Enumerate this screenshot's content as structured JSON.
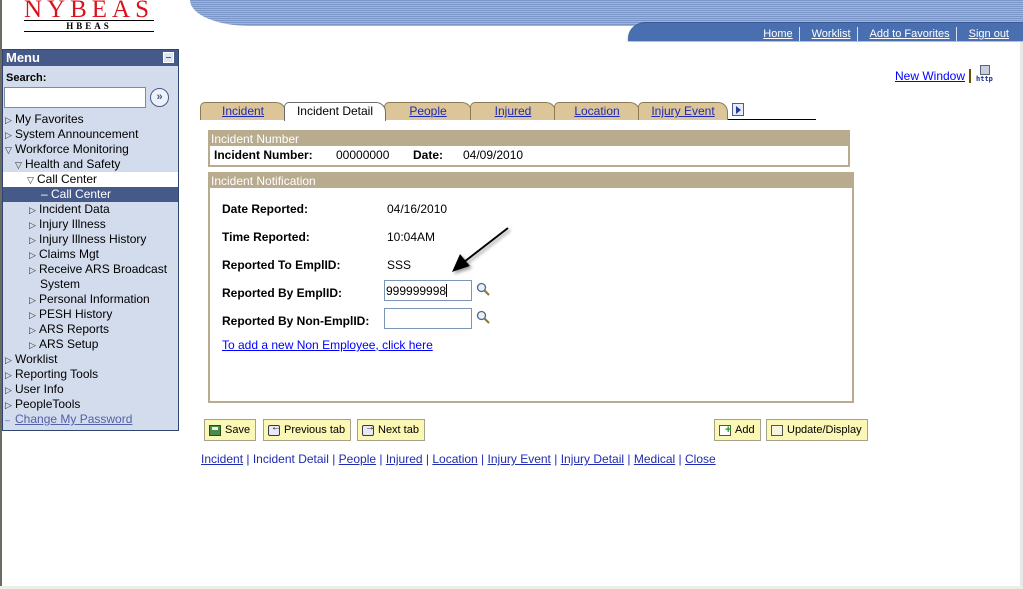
{
  "logo": {
    "main": "NYBEAS",
    "sub": "HBEAS"
  },
  "header_nav": [
    {
      "label": "Home"
    },
    {
      "label": "Worklist"
    },
    {
      "label": "Add to Favorites"
    },
    {
      "label": "Sign out"
    }
  ],
  "menu": {
    "title": "Menu",
    "search_label": "Search:",
    "search_value": "",
    "items": [
      {
        "label": "My Favorites",
        "icon": "triangle-right"
      },
      {
        "label": "System Announcement",
        "icon": "triangle-right"
      },
      {
        "label": "Workforce Monitoring",
        "icon": "triangle-down"
      },
      {
        "label": "Health and Safety",
        "icon": "triangle-down"
      },
      {
        "label": "Call Center",
        "icon": "triangle-down"
      },
      {
        "label": "Call Center",
        "icon": "dash",
        "selected": true
      },
      {
        "label": "Incident Data",
        "icon": "triangle-right"
      },
      {
        "label": "Injury Illness",
        "icon": "triangle-right"
      },
      {
        "label": "Injury Illness History",
        "icon": "triangle-right"
      },
      {
        "label": "Claims Mgt",
        "icon": "triangle-right"
      },
      {
        "label": "Receive ARS Broadcast",
        "icon": "triangle-right"
      },
      {
        "label": "System",
        "icon": ""
      },
      {
        "label": "Personal Information",
        "icon": "triangle-right"
      },
      {
        "label": "PESH History",
        "icon": "triangle-right"
      },
      {
        "label": "ARS Reports",
        "icon": "triangle-right"
      },
      {
        "label": "ARS Setup",
        "icon": "triangle-right"
      },
      {
        "label": "Worklist",
        "icon": "triangle-right"
      },
      {
        "label": "Reporting Tools",
        "icon": "triangle-right"
      },
      {
        "label": "User Info",
        "icon": "triangle-right"
      },
      {
        "label": "PeopleTools",
        "icon": "triangle-right"
      },
      {
        "label": "Change My Password",
        "icon": "dash"
      }
    ]
  },
  "new_window": {
    "label": "New Window",
    "icon": "http-icon"
  },
  "tabs": [
    {
      "label": "Incident",
      "active": false
    },
    {
      "label": "Incident Detail",
      "active": true
    },
    {
      "label": "People",
      "active": false
    },
    {
      "label": "Injured",
      "active": false
    },
    {
      "label": "Location",
      "active": false
    },
    {
      "label": "Injury Event",
      "active": false
    }
  ],
  "incident_number_group": {
    "title": "Incident Number",
    "number_label": "Incident Number:",
    "number_value": "00000000",
    "date_label": "Date:",
    "date_value": "04/09/2010"
  },
  "notification_group": {
    "title": "Incident Notification",
    "date_reported_label": "Date Reported:",
    "date_reported_value": "04/16/2010",
    "time_reported_label": "Time Reported:",
    "time_reported_value": "10:04AM",
    "reported_to_label": "Reported To EmplID:",
    "reported_to_value": "SSS",
    "reported_by_label": "Reported By EmplID:",
    "reported_by_value": "999999998",
    "reported_by_non_label": "Reported By Non-EmplID:",
    "reported_by_non_value": "",
    "add_link": "To add a new Non Employee, click here"
  },
  "toolbar": {
    "save": "Save",
    "previous_tab": "Previous tab",
    "next_tab": "Next tab",
    "add": "Add",
    "update_display": "Update/Display"
  },
  "bottom_links": [
    {
      "label": "Incident",
      "link": true
    },
    {
      "label": "Incident Detail",
      "link": false
    },
    {
      "label": "People",
      "link": true
    },
    {
      "label": "Injured",
      "link": true
    },
    {
      "label": "Location",
      "link": true
    },
    {
      "label": "Injury Event",
      "link": true
    },
    {
      "label": "Injury Detail",
      "link": true
    },
    {
      "label": "Medical",
      "link": true
    },
    {
      "label": "Close",
      "link": true
    }
  ]
}
